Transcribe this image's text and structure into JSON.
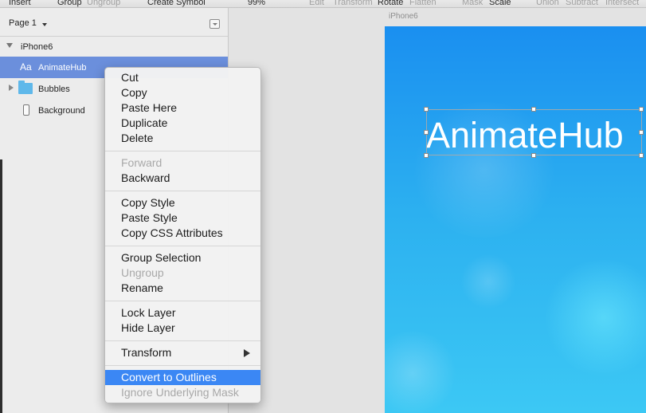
{
  "toolbar": {
    "insert": "Insert",
    "group": "Group",
    "ungroup": "Ungroup",
    "create_symbol": "Create Symbol",
    "zoom": "99%",
    "edit": "Edit",
    "transform": "Transform",
    "rotate": "Rotate",
    "flatten": "Flatten",
    "mask": "Mask",
    "scale": "Scale",
    "union": "Union",
    "subtract": "Subtract",
    "intersect": "Intersect"
  },
  "layers": {
    "page": "Page 1",
    "artboard": "iPhone6",
    "items": [
      {
        "label": "AnimateHub",
        "icon": "text-layer-icon",
        "icon_text": "Aa",
        "selected": true
      },
      {
        "label": "Bubbles",
        "icon": "folder-icon"
      },
      {
        "label": "Background",
        "icon": "rectangle-icon"
      }
    ]
  },
  "canvas": {
    "artboard_title": "iPhone6",
    "headline": "AnimateHub",
    "gradient_top": "#1a8ff0",
    "gradient_bottom": "#3cc8f4"
  },
  "context_menu": {
    "groups": [
      [
        "Cut",
        "Copy",
        "Paste Here",
        "Duplicate",
        "Delete"
      ],
      [
        "Forward",
        "Backward"
      ],
      [
        "Copy Style",
        "Paste Style",
        "Copy CSS Attributes"
      ],
      [
        "Group Selection",
        "Ungroup",
        "Rename"
      ],
      [
        "Lock Layer",
        "Hide Layer"
      ],
      [
        "Transform"
      ],
      [
        "Convert to Outlines",
        "Ignore Underlying Mask"
      ]
    ],
    "items": {
      "cut": "Cut",
      "copy": "Copy",
      "paste_here": "Paste Here",
      "duplicate": "Duplicate",
      "delete": "Delete",
      "forward": "Forward",
      "backward": "Backward",
      "copy_style": "Copy Style",
      "paste_style": "Paste Style",
      "copy_css": "Copy CSS Attributes",
      "group_selection": "Group Selection",
      "ungroup": "Ungroup",
      "rename": "Rename",
      "lock_layer": "Lock Layer",
      "hide_layer": "Hide Layer",
      "transform": "Transform",
      "convert_outlines": "Convert to Outlines",
      "ignore_mask": "Ignore Underlying Mask"
    },
    "disabled": [
      "Forward",
      "Ungroup",
      "Ignore Underlying Mask"
    ],
    "highlighted": "Convert to Outlines",
    "highlight_color": "#3b87f4"
  }
}
